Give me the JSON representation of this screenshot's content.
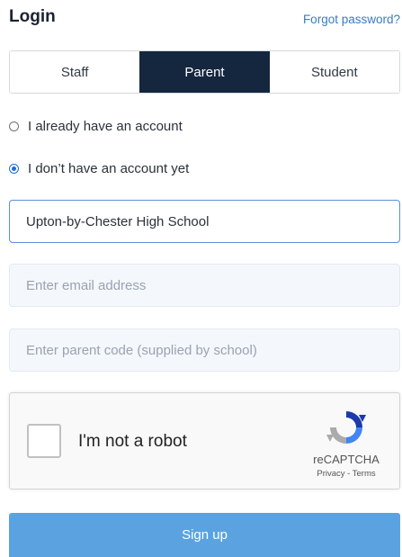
{
  "header": {
    "title": "Login",
    "forgot_password": "Forgot password?"
  },
  "tabs": [
    {
      "label": "Staff",
      "active": false
    },
    {
      "label": "Parent",
      "active": true
    },
    {
      "label": "Student",
      "active": false
    }
  ],
  "account_options": [
    {
      "label": "I already have an account",
      "checked": false
    },
    {
      "label": "I don’t have an account yet",
      "checked": true
    }
  ],
  "form": {
    "school_value": "Upton-by-Chester High School",
    "email_placeholder": "Enter email address",
    "parent_code_placeholder": "Enter parent code (supplied by school)"
  },
  "captcha": {
    "label": "I'm not a robot",
    "brand": "reCAPTCHA",
    "links": "Privacy - Terms"
  },
  "signup_label": "Sign up",
  "colors": {
    "accent_dark": "#15263f",
    "link": "#3a7bbf",
    "button": "#5aa3e0",
    "radio_selected": "#1a6fe0"
  }
}
